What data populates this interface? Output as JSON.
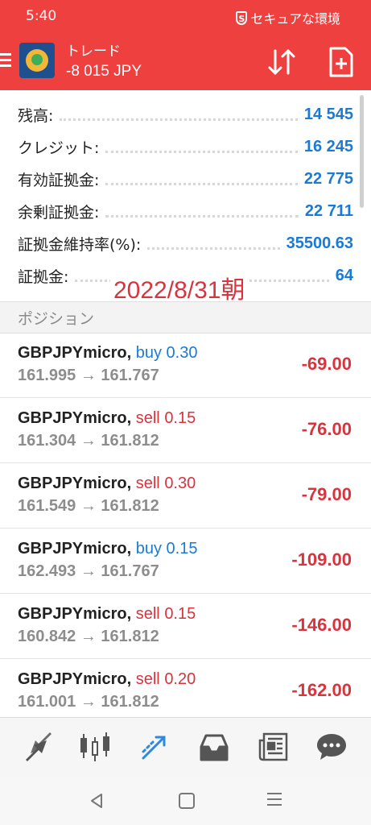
{
  "status_bar": {
    "time": "5:40",
    "security_text": "セキュアな環境",
    "shield_glyph": "S"
  },
  "app_bar": {
    "title": "トレード",
    "balance": "-8 015 JPY",
    "icons": [
      "menu-icon",
      "app-logo",
      "sort-arrows-icon",
      "add-document-icon"
    ],
    "accent_color": "#ef4040"
  },
  "account": [
    {
      "label": "残高:",
      "value": "14 545"
    },
    {
      "label": "クレジット:",
      "value": "16 245"
    },
    {
      "label": "有効証拠金:",
      "value": "22 775"
    },
    {
      "label": "余剰証拠金:",
      "value": "22 711"
    },
    {
      "label": "証拠金維持率(%):",
      "value": "35500.63"
    },
    {
      "label": "証拠金:",
      "value": "64"
    }
  ],
  "overlay_date": "2022/8/31朝",
  "positions_title": "ポジション",
  "positions": [
    {
      "symbol": "GBPJPYmicro,",
      "side": "buy",
      "volume": "0.30",
      "prices": "161.995 → 161.767",
      "profit": "-69.00"
    },
    {
      "symbol": "GBPJPYmicro,",
      "side": "sell",
      "volume": "0.15",
      "prices": "161.304 → 161.812",
      "profit": "-76.00"
    },
    {
      "symbol": "GBPJPYmicro,",
      "side": "sell",
      "volume": "0.30",
      "prices": "161.549 → 161.812",
      "profit": "-79.00"
    },
    {
      "symbol": "GBPJPYmicro,",
      "side": "buy",
      "volume": "0.15",
      "prices": "162.493 → 161.767",
      "profit": "-109.00"
    },
    {
      "symbol": "GBPJPYmicro,",
      "side": "sell",
      "volume": "0.15",
      "prices": "160.842 → 161.812",
      "profit": "-146.00"
    },
    {
      "symbol": "GBPJPYmicro,",
      "side": "sell",
      "volume": "0.20",
      "prices": "161.001 → 161.812",
      "profit": "-162.00"
    }
  ],
  "colors": {
    "buy": "#1a7bd6",
    "sell": "#d8343e",
    "loss": "#d8343e",
    "value": "#1a7bd6"
  },
  "tabbar": {
    "tabs": [
      "quotes-icon",
      "chart-icon",
      "trade-icon",
      "history-icon",
      "news-icon",
      "chat-icon"
    ],
    "active": "trade-icon"
  },
  "system_nav": [
    "back-icon",
    "home-icon",
    "recents-icon"
  ]
}
